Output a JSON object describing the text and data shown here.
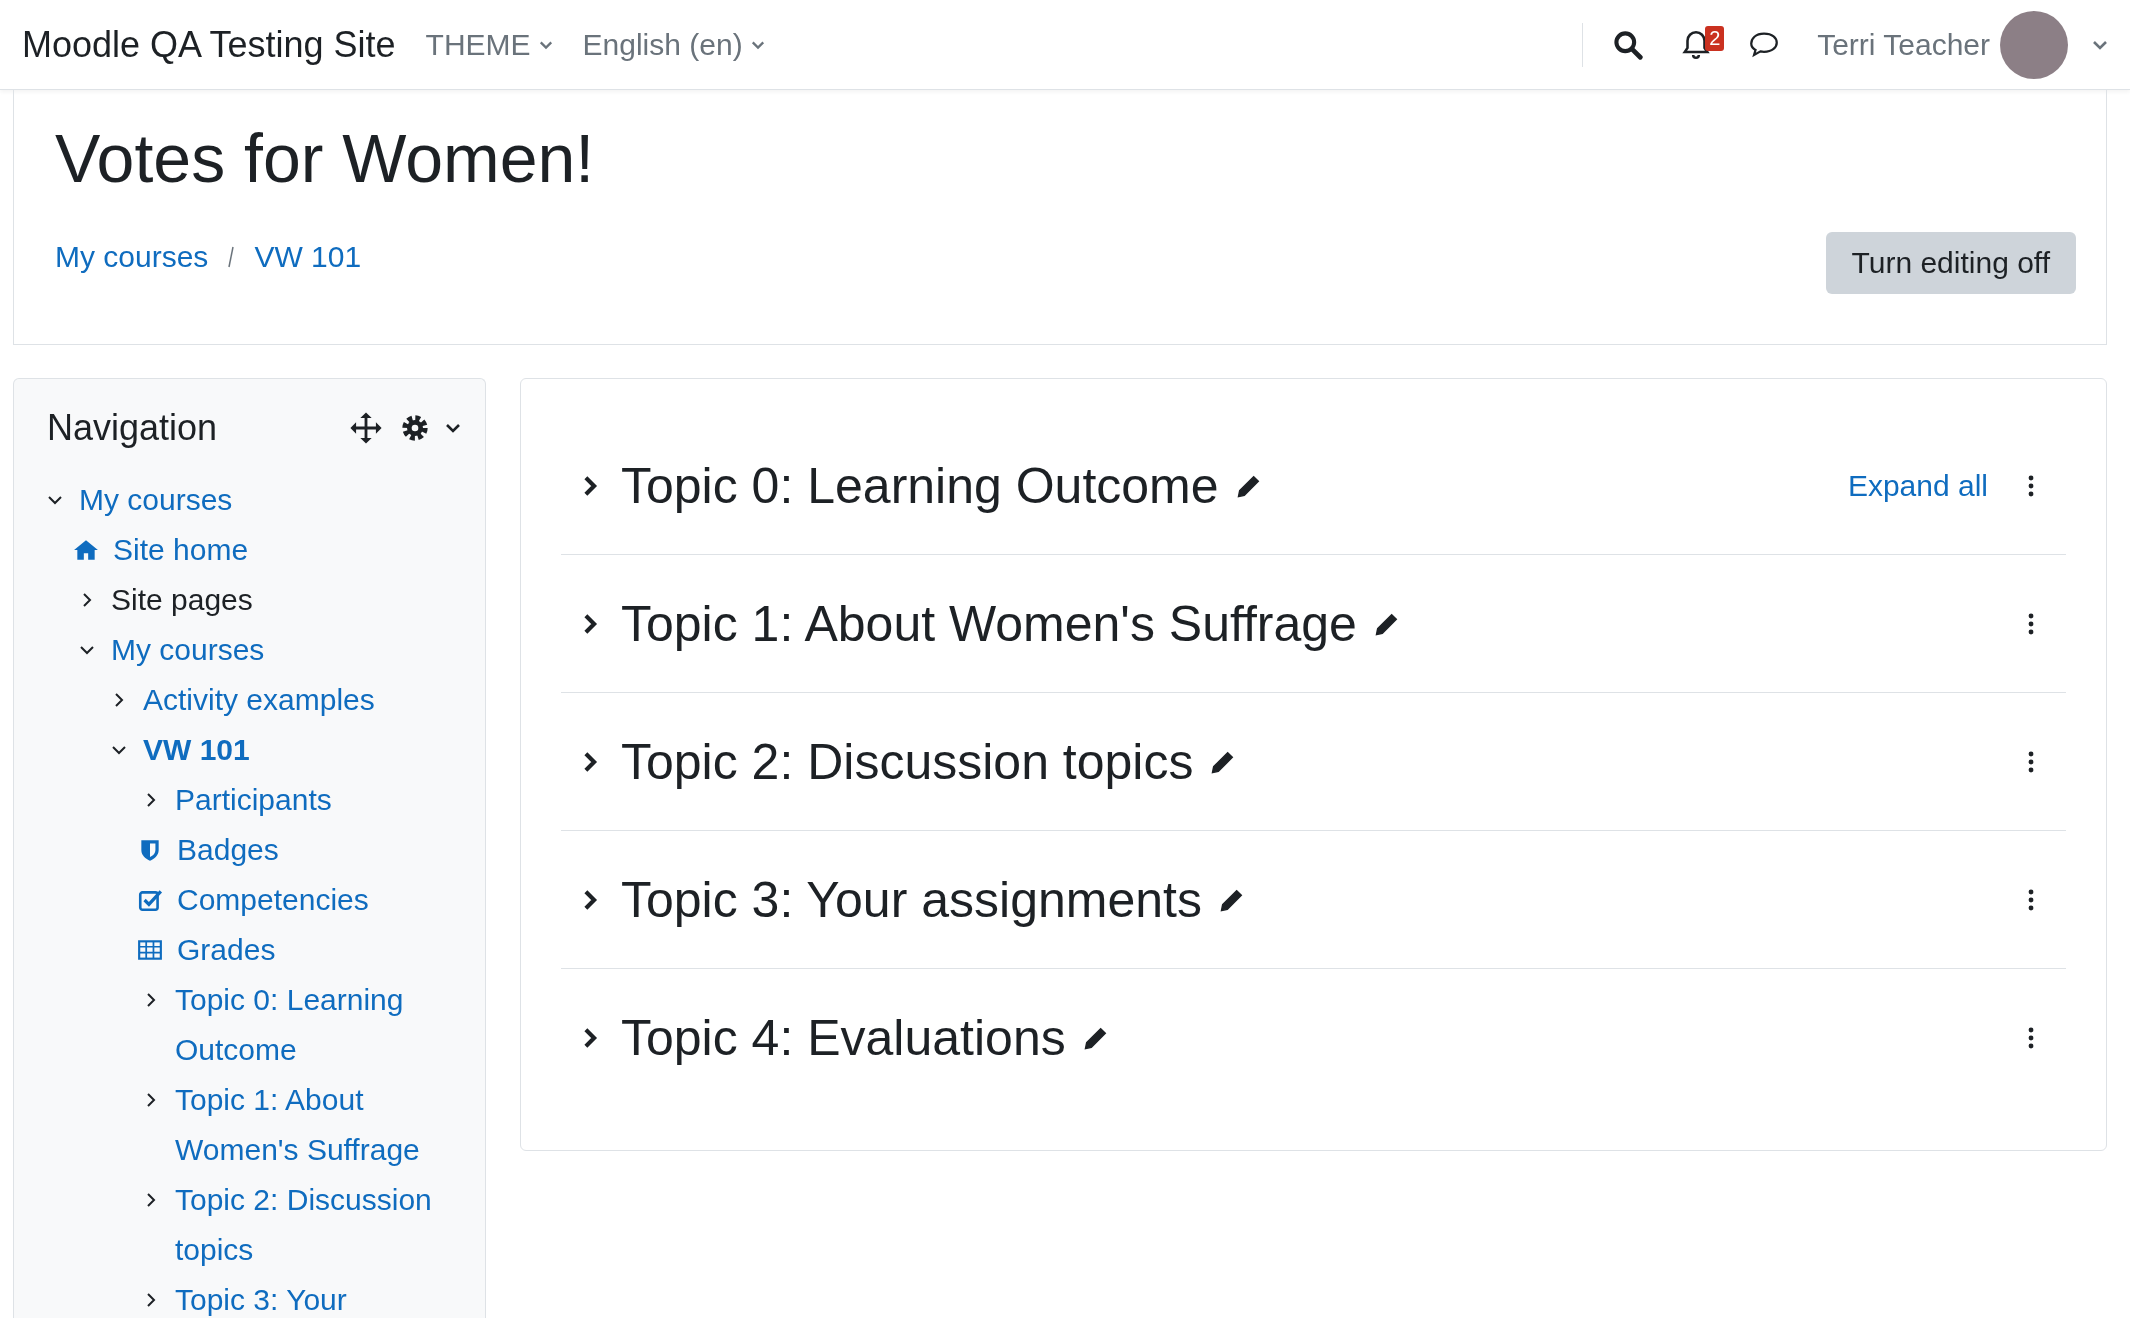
{
  "navbar": {
    "site_name": "Moodle QA Testing Site",
    "menus": [
      "THEME",
      "English (en)"
    ],
    "notification_count": "2",
    "user_name": "Terri Teacher"
  },
  "page_header": {
    "title": "Votes for Women!",
    "breadcrumbs": [
      "My courses",
      "VW 101"
    ],
    "edit_button": "Turn editing off"
  },
  "navigation": {
    "title": "Navigation",
    "items": [
      {
        "label": "My courses",
        "kind": "branch",
        "expanded": true,
        "link": true,
        "current": false,
        "children": [
          {
            "label": "Site home",
            "kind": "home",
            "link": true,
            "current": false
          },
          {
            "label": "Site pages",
            "kind": "branch",
            "expanded": false,
            "link": false,
            "current": false
          },
          {
            "label": "My courses",
            "kind": "branch",
            "expanded": true,
            "link": true,
            "current": false,
            "children": [
              {
                "label": "Activity examples",
                "kind": "branch",
                "expanded": false,
                "link": true,
                "current": false
              },
              {
                "label": "VW 101",
                "kind": "branch",
                "expanded": true,
                "link": true,
                "current": true,
                "children": [
                  {
                    "label": "Participants",
                    "kind": "branch",
                    "expanded": false,
                    "link": true,
                    "current": false
                  },
                  {
                    "label": "Badges",
                    "kind": "badge",
                    "link": true,
                    "current": false
                  },
                  {
                    "label": "Competencies",
                    "kind": "competency",
                    "link": true,
                    "current": false
                  },
                  {
                    "label": "Grades",
                    "kind": "grades",
                    "link": true,
                    "current": false
                  },
                  {
                    "label": "Topic 0: Learning Outcome",
                    "kind": "branch",
                    "expanded": false,
                    "link": true,
                    "current": false
                  },
                  {
                    "label": "Topic 1: About Women's Suffrage",
                    "kind": "branch",
                    "expanded": false,
                    "link": true,
                    "current": false
                  },
                  {
                    "label": "Topic 2: Discussion topics",
                    "kind": "branch",
                    "expanded": false,
                    "link": true,
                    "current": false
                  },
                  {
                    "label": "Topic 3: Your",
                    "kind": "branch",
                    "expanded": false,
                    "link": true,
                    "current": false
                  }
                ]
              }
            ]
          }
        ]
      }
    ]
  },
  "course": {
    "expand_all": "Expand all",
    "sections": [
      {
        "title": "Topic 0: Learning Outcome",
        "expanded": false
      },
      {
        "title": "Topic 1: About Women's Suffrage",
        "expanded": false
      },
      {
        "title": "Topic 2: Discussion topics",
        "expanded": false
      },
      {
        "title": "Topic 3: Your assignments",
        "expanded": false
      },
      {
        "title": "Topic 4: Evaluations",
        "expanded": false
      }
    ]
  }
}
